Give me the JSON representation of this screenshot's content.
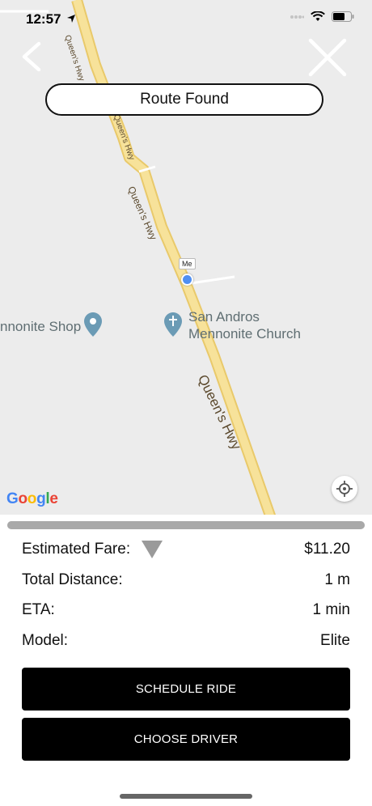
{
  "status_bar": {
    "time": "12:57"
  },
  "route_status": "Route Found",
  "map": {
    "roads": [
      "Queen's Hwy",
      "Queen's Hwy",
      "Queen's Hwy",
      "Queen's Hwy"
    ],
    "user_marker": "Me",
    "pois": [
      {
        "name": "nnonite Shop"
      },
      {
        "name_line1": "San Andros",
        "name_line2": "Mennonite Church"
      }
    ],
    "attribution": [
      "G",
      "o",
      "o",
      "g",
      "l",
      "e"
    ]
  },
  "progress": {
    "fraction": 0.0
  },
  "trip": {
    "estimated_fare_label": "Estimated Fare:",
    "estimated_fare_value": "$11.20",
    "total_distance_label": "Total Distance:",
    "total_distance_value": "1 m",
    "eta_label": "ETA:",
    "eta_value": "1 min",
    "model_label": "Model:",
    "model_value": "Elite"
  },
  "actions": {
    "schedule_ride": "SCHEDULE RIDE",
    "choose_driver": "CHOOSE DRIVER"
  },
  "colors": {
    "road_fill": "#f7e29a",
    "road_edge": "#e9c96a",
    "accent_dot": "#4f8ff2",
    "button_bg": "#000000"
  }
}
